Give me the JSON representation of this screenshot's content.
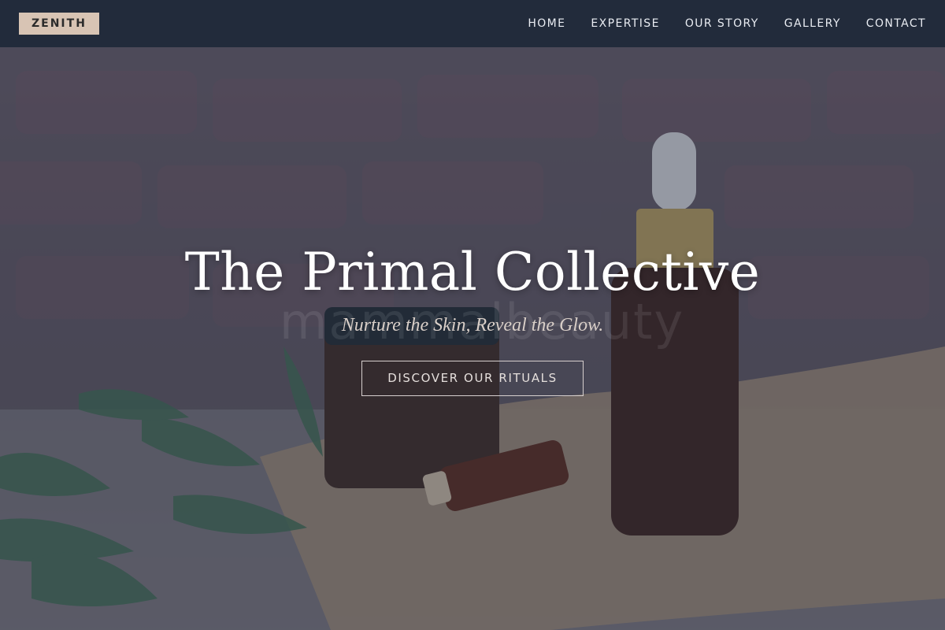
{
  "header": {
    "brand": "ZENITH",
    "nav": [
      {
        "label": "HOME"
      },
      {
        "label": "EXPERTISE"
      },
      {
        "label": "OUR STORY"
      },
      {
        "label": "GALLERY"
      },
      {
        "label": "CONTACT"
      }
    ]
  },
  "hero": {
    "title": "The Primal Collective",
    "subtitle": "Nurture the Skin, Reveal the Glow.",
    "cta_label": "DISCOVER OUR RITUALS",
    "background_watermark": "mammalbeauty",
    "background_image": "skincare-bottles-photo"
  },
  "colors": {
    "header_bg": "#222b3b",
    "brand_badge": "#d8c4b4",
    "overlay": "#282c3e"
  }
}
